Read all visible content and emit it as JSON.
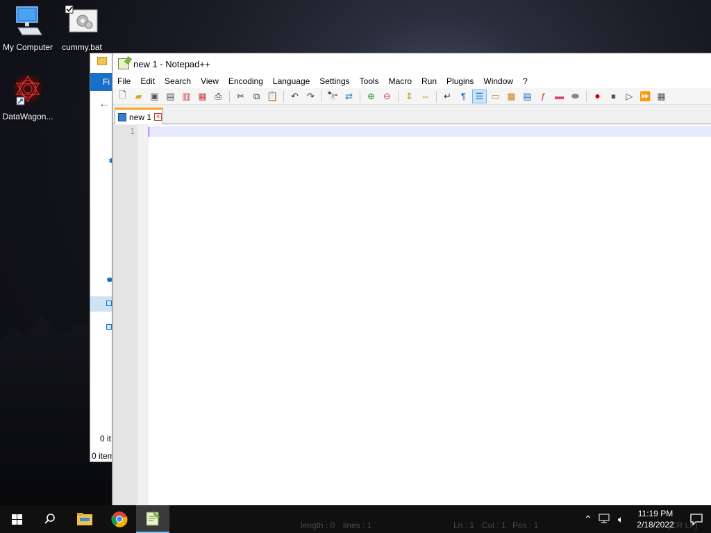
{
  "desktop": {
    "icons": [
      {
        "label": "My Computer",
        "icon": "computer-icon"
      },
      {
        "label": "cummy.bat",
        "icon": "batch-file-icon"
      },
      {
        "label": "DataWagon...",
        "icon": "datawagon-icon"
      }
    ]
  },
  "explorer": {
    "ribbon_tab": "Fi",
    "status_top": "0 it",
    "status_bottom": "0 item"
  },
  "notepad": {
    "title": "new 1 - Notepad++",
    "menu": [
      "File",
      "Edit",
      "Search",
      "View",
      "Encoding",
      "Language",
      "Settings",
      "Tools",
      "Macro",
      "Run",
      "Plugins",
      "Window",
      "?"
    ],
    "tab_label": "new 1",
    "line_number": "1",
    "caret_color": "#8000ff",
    "current_line_color": "#e8e8ff"
  },
  "taskbar": {
    "status_ghost": {
      "length": "length : 0",
      "lines": "lines : 1",
      "ln": "Ln : 1",
      "col": "Col : 1",
      "pos": "Pos : 1",
      "crlf": "(CR LF)"
    },
    "time": "11:19 PM",
    "date": "2/18/2022",
    "accent": "#76b9ed"
  }
}
